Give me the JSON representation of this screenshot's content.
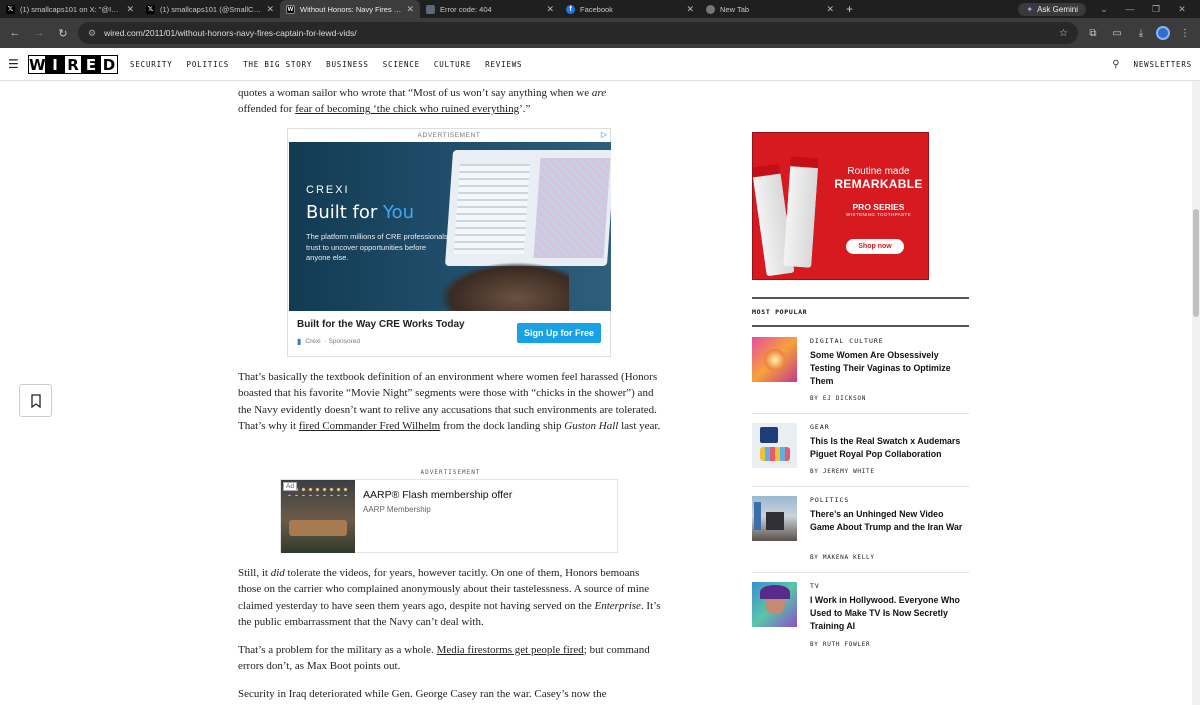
{
  "browser": {
    "tabs": [
      {
        "title": "(1) smallcaps101 on X: \"@IG_N",
        "icon": "x-icon",
        "active": false
      },
      {
        "title": "(1) smallcaps101 (@SmallCaps1",
        "icon": "x-icon",
        "active": false
      },
      {
        "title": "Without Honors: Navy Fires Cap",
        "icon": "wired-icon",
        "active": true
      },
      {
        "title": "Error code: 404",
        "icon": "error-icon",
        "active": false
      },
      {
        "title": "Facebook",
        "icon": "facebook-icon",
        "active": false
      },
      {
        "title": "New Tab",
        "icon": "chrome-icon",
        "active": false
      }
    ],
    "ask_gemini": "Ask Gemini",
    "url": "wired.com/2011/01/without-honors-navy-fires-captain-for-lewd-vids/"
  },
  "site": {
    "logo_letters": [
      "W",
      "I",
      "R",
      "E",
      "D"
    ],
    "nav": [
      "SECURITY",
      "POLITICS",
      "THE BIG STORY",
      "BUSINESS",
      "SCIENCE",
      "CULTURE",
      "REVIEWS"
    ],
    "newsletters": "NEWSLETTERS"
  },
  "article": {
    "top_line1": "quotes a woman sailor who wrote that “Most of us won’t say anything when we ",
    "top_line1_em": "are",
    "top_line2_pre": "offended for ",
    "top_line2_link": "fear of becoming ‘the chick who ruined everything",
    "top_line2_post": "’.”",
    "p1_pre": "That’s basically the textbook definition of an environment where women feel harassed (Honors boasted that his favorite “Movie Night” segments were those with “chicks in the shower”) and the Navy evidently doesn’t want to relive any accusations that such environments are tolerated. That’s why it ",
    "p1_link": "fired Commander Fred Wilhelm",
    "p1_mid": " from the dock landing ship ",
    "p1_em": "Guston Hall",
    "p1_post": " last year.",
    "p2_pre": "Still, it ",
    "p2_em": "did",
    "p2_mid": " tolerate the videos, for years, however tacitly. On one of them, Honors bemoans those on the carrier who complained anonymously about their tastelessness. A source of mine claimed yesterday to have seen them years ago, despite not having served on the ",
    "p2_em2": "Enterprise",
    "p2_post": ". It’s the public embarrassment that the Navy can’t deal with.",
    "p3_pre": "That’s a problem for the military as a whole. ",
    "p3_link": "Media firestorms get people fired",
    "p3_post": "; but command errors don’t, as Max Boot points out.",
    "p4": "Security in Iraq deteriorated while Gen. George Casey ran the war. Casey’s now the"
  },
  "ad1": {
    "label": "ADVERTISEMENT",
    "brand": "CREXI",
    "headline_pre": "Built for ",
    "headline_accent": "You",
    "blurb": "The platform millions of CRE professionals trust to uncover opportunities before anyone else.",
    "footer_title": "Built for the Way CRE Works Today",
    "footer_brand": "Crexi",
    "footer_sponsored": "· Sponsored",
    "cta": "Sign Up for Free"
  },
  "ad2": {
    "label": "ADVERTISEMENT",
    "tag": "Ad",
    "headline": "AARP® Flash membership offer",
    "sub": "AARP Membership"
  },
  "right_ad": {
    "headline_top": "Routine made",
    "headline_bold": "REMARKABLE",
    "pro": "PRO SERIES",
    "pro_sub": "WHITENING TOOTHPASTE",
    "shop": "Shop now"
  },
  "most_popular": {
    "title": "MOST POPULAR",
    "items": [
      {
        "category": "DIGITAL CULTURE",
        "headline": "Some Women Are Obsessively Testing Their Vaginas to Optimize Them",
        "byline": "BY EJ DICKSON"
      },
      {
        "category": "GEAR",
        "headline": "This Is the Real Swatch x Audemars Piguet Royal Pop Collaboration",
        "byline": "BY JEREMY WHITE"
      },
      {
        "category": "POLITICS",
        "headline": "There’s an Unhinged New Video Game About Trump and the Iran War",
        "byline": "BY MAKENA KELLY"
      },
      {
        "category": "TV",
        "headline": "I Work in Hollywood. Everyone Who Used to Make TV Is Now Secretly Training AI",
        "byline": "BY RUTH FOWLER"
      }
    ]
  },
  "colors": {
    "chrome_dark": "#1f1f1f",
    "toolbar": "#3c3c3c",
    "colgate_red": "#d71920",
    "crexi_blue": "#19a1e6"
  }
}
